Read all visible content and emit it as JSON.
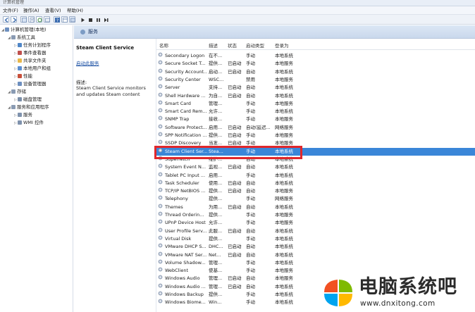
{
  "window": {
    "title": "计算机管理"
  },
  "menu": [
    "文件(F)",
    "操作(A)",
    "查看(V)",
    "帮助(H)"
  ],
  "tree": [
    {
      "label": "计算机管理(本地)",
      "level": 0,
      "icon": "computer-icon",
      "color": "#6d8fbf"
    },
    {
      "label": "系统工具",
      "level": 1,
      "icon": "tools-icon",
      "color": "#8a9bb3"
    },
    {
      "label": "任务计划程序",
      "level": 2,
      "icon": "clock-icon",
      "color": "#4f86c6"
    },
    {
      "label": "事件查看器",
      "level": 2,
      "icon": "event-viewer-icon",
      "color": "#c0504d"
    },
    {
      "label": "共享文件夹",
      "level": 2,
      "icon": "folder-icon",
      "color": "#e8b84a"
    },
    {
      "label": "本地用户和组",
      "level": 2,
      "icon": "users-icon",
      "color": "#5b8ed0"
    },
    {
      "label": "性能",
      "level": 2,
      "icon": "performance-icon",
      "color": "#c8503b"
    },
    {
      "label": "设备管理器",
      "level": 2,
      "icon": "device-manager-icon",
      "color": "#6d8fbf"
    },
    {
      "label": "存储",
      "level": 1,
      "icon": "storage-icon",
      "color": "#8a9bb3"
    },
    {
      "label": "磁盘管理",
      "level": 2,
      "icon": "disk-icon",
      "color": "#7a8ea8"
    },
    {
      "label": "服务和应用程序",
      "level": 1,
      "icon": "services-apps-icon",
      "color": "#8a9bb3"
    },
    {
      "label": "服务",
      "level": 2,
      "icon": "services-icon",
      "color": "#7f92ad"
    },
    {
      "label": "WMI 控件",
      "level": 2,
      "icon": "wmi-icon",
      "color": "#7f92ad"
    }
  ],
  "header": {
    "title": "服务"
  },
  "details": {
    "service_name": "Steam Client Service",
    "action_link": "启动此服务",
    "desc_label": "描述:",
    "desc_text": "Steam Client Service monitors and updates Steam content"
  },
  "columns": [
    "名称",
    "描述",
    "状态",
    "启动类型",
    "登录为"
  ],
  "services": [
    {
      "name": "Secondary Logon",
      "desc": "在不...",
      "status": "",
      "startup": "手动",
      "logon": "本地系统"
    },
    {
      "name": "Secure Socket T...",
      "desc": "提供...",
      "status": "已启动",
      "startup": "手动",
      "logon": "本地服务"
    },
    {
      "name": "Security Account...",
      "desc": "启动...",
      "status": "已启动",
      "startup": "自动",
      "logon": "本地系统"
    },
    {
      "name": "Security Center",
      "desc": "WSC...",
      "status": "",
      "startup": "禁用",
      "logon": "本地服务"
    },
    {
      "name": "Server",
      "desc": "支持...",
      "status": "已启动",
      "startup": "自动",
      "logon": "本地系统"
    },
    {
      "name": "Shell Hardware ...",
      "desc": "为自...",
      "status": "已启动",
      "startup": "自动",
      "logon": "本地系统"
    },
    {
      "name": "Smart Card",
      "desc": "管理...",
      "status": "",
      "startup": "手动",
      "logon": "本地服务"
    },
    {
      "name": "Smart Card Rem...",
      "desc": "允许...",
      "status": "",
      "startup": "手动",
      "logon": "本地系统"
    },
    {
      "name": "SNMP Trap",
      "desc": "接收...",
      "status": "",
      "startup": "手动",
      "logon": "本地服务"
    },
    {
      "name": "Software Protect...",
      "desc": "启用...",
      "status": "已启动",
      "startup": "自动(延迟...",
      "logon": "网络服务"
    },
    {
      "name": "SPP Notification ...",
      "desc": "提供...",
      "status": "已启动",
      "startup": "手动",
      "logon": "本地服务"
    },
    {
      "name": "SSDP Discovery",
      "desc": "当发...",
      "status": "已启动",
      "startup": "手动",
      "logon": "本地服务"
    },
    {
      "name": "Steam Client Ser...",
      "desc": "Stea...",
      "status": "",
      "startup": "手动",
      "logon": "本地系统"
    },
    {
      "name": "Superfetch",
      "desc": "维护...",
      "status": "",
      "startup": "自动",
      "logon": "本地系统"
    },
    {
      "name": "System Event N...",
      "desc": "监视...",
      "status": "已启动",
      "startup": "自动",
      "logon": "本地系统"
    },
    {
      "name": "Tablet PC Input ...",
      "desc": "启用...",
      "status": "",
      "startup": "手动",
      "logon": "本地系统"
    },
    {
      "name": "Task Scheduler",
      "desc": "使用...",
      "status": "已启动",
      "startup": "自动",
      "logon": "本地系统"
    },
    {
      "name": "TCP/IP NetBIOS ...",
      "desc": "提供...",
      "status": "已启动",
      "startup": "自动",
      "logon": "本地服务"
    },
    {
      "name": "Telephony",
      "desc": "提供...",
      "status": "",
      "startup": "手动",
      "logon": "网络服务"
    },
    {
      "name": "Themes",
      "desc": "为用...",
      "status": "已启动",
      "startup": "自动",
      "logon": "本地系统"
    },
    {
      "name": "Thread Orderin...",
      "desc": "提供...",
      "status": "",
      "startup": "手动",
      "logon": "本地服务"
    },
    {
      "name": "UPnP Device Host",
      "desc": "允许...",
      "status": "",
      "startup": "手动",
      "logon": "本地服务"
    },
    {
      "name": "User Profile Serv...",
      "desc": "此服...",
      "status": "已启动",
      "startup": "自动",
      "logon": "本地系统"
    },
    {
      "name": "Virtual Disk",
      "desc": "提供...",
      "status": "",
      "startup": "手动",
      "logon": "本地系统"
    },
    {
      "name": "VMware DHCP S...",
      "desc": "DHC...",
      "status": "已启动",
      "startup": "自动",
      "logon": "本地系统"
    },
    {
      "name": "VMware NAT Ser...",
      "desc": "Net...",
      "status": "已启动",
      "startup": "自动",
      "logon": "本地系统"
    },
    {
      "name": "Volume Shadow...",
      "desc": "管理...",
      "status": "",
      "startup": "手动",
      "logon": "本地系统"
    },
    {
      "name": "WebClient",
      "desc": "使基...",
      "status": "",
      "startup": "手动",
      "logon": "本地服务"
    },
    {
      "name": "Windows Audio",
      "desc": "管理...",
      "status": "已启动",
      "startup": "自动",
      "logon": "本地服务"
    },
    {
      "name": "Windows Audio ...",
      "desc": "管理...",
      "status": "已启动",
      "startup": "自动",
      "logon": "本地系统"
    },
    {
      "name": "Windows Backup",
      "desc": "提供...",
      "status": "",
      "startup": "手动",
      "logon": "本地系统"
    },
    {
      "name": "Windows Biome...",
      "desc": "Win...",
      "status": "",
      "startup": "手动",
      "logon": "本地系统"
    }
  ],
  "selected_index": 12,
  "brand": {
    "name": "电脑系统吧",
    "url": "www.dnxitong.com"
  },
  "colors": {
    "accent": "#3a86d8",
    "highlight_box": "#e0272b"
  }
}
